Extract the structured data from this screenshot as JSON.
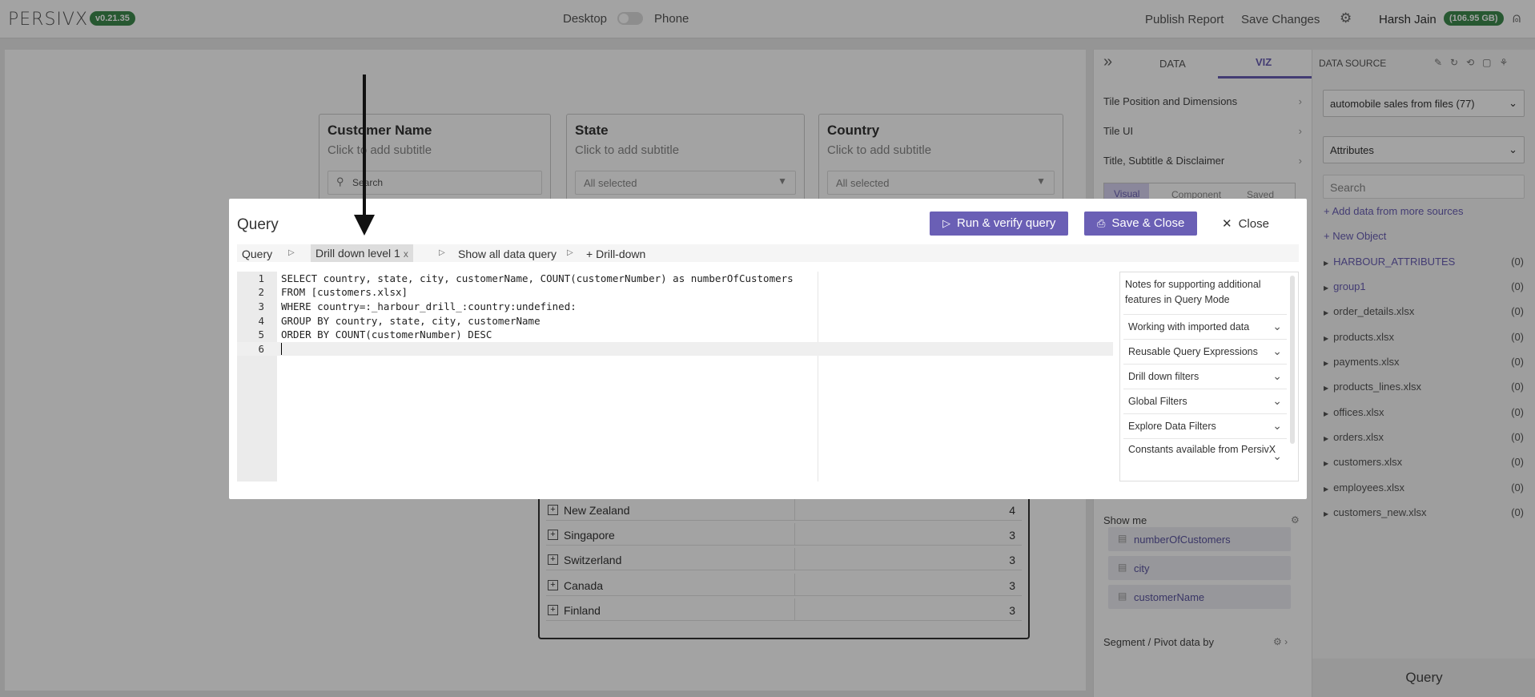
{
  "topbar": {
    "logo": "PERSIVX",
    "version": "v0.21.35",
    "mode_desktop": "Desktop",
    "mode_phone": "Phone",
    "publish": "Publish Report",
    "save_changes": "Save Changes",
    "user_name": "Harsh Jain",
    "storage": "(106.95 GB)"
  },
  "tiles": [
    {
      "title": "Customer Name",
      "subtitle": "Click to add subtitle",
      "control": "Search"
    },
    {
      "title": "State",
      "subtitle": "Click to add subtitle",
      "control": "All selected"
    },
    {
      "title": "Country",
      "subtitle": "Click to add subtitle",
      "control": "All selected"
    }
  ],
  "table_rows": [
    {
      "name": "New Zealand",
      "count": "4"
    },
    {
      "name": "Singapore",
      "count": "3"
    },
    {
      "name": "Switzerland",
      "count": "3"
    },
    {
      "name": "Canada",
      "count": "3"
    },
    {
      "name": "Finland",
      "count": "3"
    }
  ],
  "viz_panel": {
    "tab_data": "DATA",
    "tab_viz": "VIZ",
    "rows": [
      "Tile Position and Dimensions",
      "Tile UI",
      "Title, Subtitle & Disclaimer"
    ],
    "subtabs": [
      "Visual",
      "Component",
      "Saved"
    ],
    "show_me": "Show me",
    "fields": [
      "numberOfCustomers",
      "city",
      "customerName"
    ],
    "segment": "Segment / Pivot data by"
  },
  "data_source": {
    "title": "DATA SOURCE",
    "source": "automobile sales from files (77)",
    "category": "Attributes",
    "search_placeholder": "Search",
    "add_data": "Add data from more sources",
    "new_object": "New Object",
    "items": [
      {
        "label": "HARBOUR_ATTRIBUTES",
        "count": "(0)",
        "link": true
      },
      {
        "label": "group1",
        "count": "(0)",
        "link": true
      },
      {
        "label": "order_details.xlsx",
        "count": "(0)",
        "link": false
      },
      {
        "label": "products.xlsx",
        "count": "(0)",
        "link": false
      },
      {
        "label": "payments.xlsx",
        "count": "(0)",
        "link": false
      },
      {
        "label": "products_lines.xlsx",
        "count": "(0)",
        "link": false
      },
      {
        "label": "offices.xlsx",
        "count": "(0)",
        "link": false
      },
      {
        "label": "orders.xlsx",
        "count": "(0)",
        "link": false
      },
      {
        "label": "customers.xlsx",
        "count": "(0)",
        "link": false
      },
      {
        "label": "employees.xlsx",
        "count": "(0)",
        "link": false
      },
      {
        "label": "customers_new.xlsx",
        "count": "(0)",
        "link": false
      }
    ],
    "footer": "Query"
  },
  "modal": {
    "title": "Query",
    "run_button": "Run & verify query",
    "save_button": "Save & Close",
    "close_button": "Close",
    "breadcrumbs": [
      "Query",
      "Drill down level 1",
      "Show all data query",
      "Drill-down"
    ],
    "remove": "x",
    "code_lines": [
      "SELECT country, state, city, customerName, COUNT(customerNumber) as numberOfCustomers",
      "FROM [customers.xlsx]",
      "WHERE country=:_harbour_drill_:country:undefined:",
      "GROUP BY country, state, city, customerName",
      "ORDER BY COUNT(customerNumber) DESC",
      ""
    ],
    "line_numbers": [
      "1",
      "2",
      "3",
      "4",
      "5",
      "6"
    ],
    "notes_header": "Notes for supporting additional features in Query Mode",
    "notes": [
      "Working with imported data",
      "Reusable Query Expressions",
      "Drill down filters",
      "Global Filters",
      "Explore Data Filters",
      "Constants available from PersivX"
    ]
  }
}
